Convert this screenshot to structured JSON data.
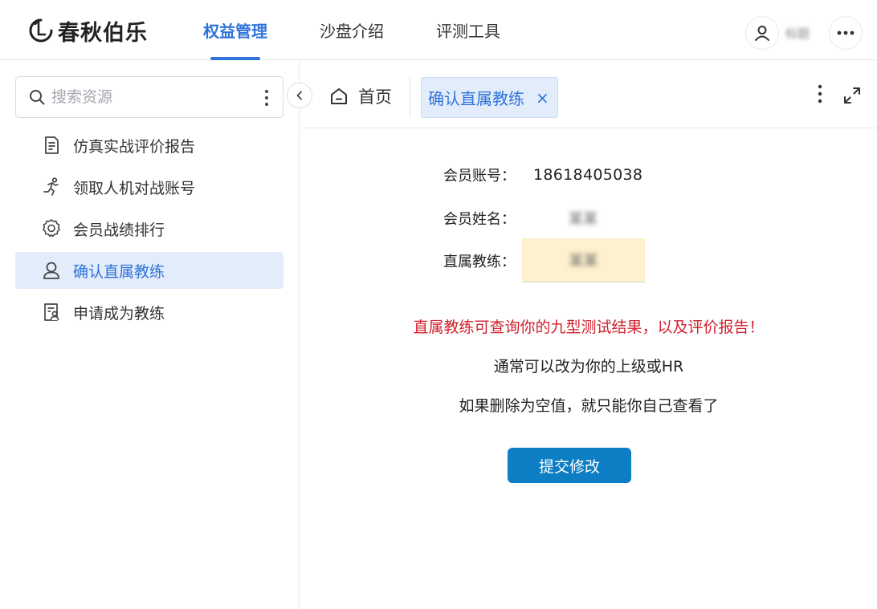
{
  "app": {
    "logo_text": "春秋伯乐"
  },
  "nav": {
    "items": [
      {
        "label": "权益管理",
        "active": true
      },
      {
        "label": "沙盘介绍",
        "active": false
      },
      {
        "label": "评测工具",
        "active": false
      }
    ]
  },
  "user": {
    "name": "标题"
  },
  "sidebar": {
    "search_placeholder": "搜索资源",
    "items": [
      {
        "label": "仿真实战评价报告",
        "icon": "report-icon"
      },
      {
        "label": "领取人机对战账号",
        "icon": "runner-icon"
      },
      {
        "label": "会员战绩排行",
        "icon": "badge-icon"
      },
      {
        "label": "确认直属教练",
        "icon": "person-icon",
        "active": true
      },
      {
        "label": "申请成为教练",
        "icon": "id-card-icon"
      }
    ]
  },
  "tabs": {
    "home_label": "首页",
    "active_label": "确认直属教练",
    "close_symbol": "×"
  },
  "form": {
    "account_label": "会员账号：",
    "account_value": "18618405038",
    "name_label": "会员姓名：",
    "name_value": "某某",
    "coach_label": "直属教练：",
    "coach_value": "某某"
  },
  "messages": {
    "warning": "直属教练可查询你的九型测试结果，以及评价报告！",
    "line2": "通常可以改为你的上级或HR",
    "line3": "如果删除为空值，就只能你自己查看了"
  },
  "actions": {
    "submit_label": "提交修改"
  },
  "colors": {
    "accent": "#2f73da",
    "button": "#0d7dc4",
    "warning_text": "#d0212d",
    "coach_field_bg": "#fdf1cf",
    "active_bg": "#e3ecfb"
  }
}
